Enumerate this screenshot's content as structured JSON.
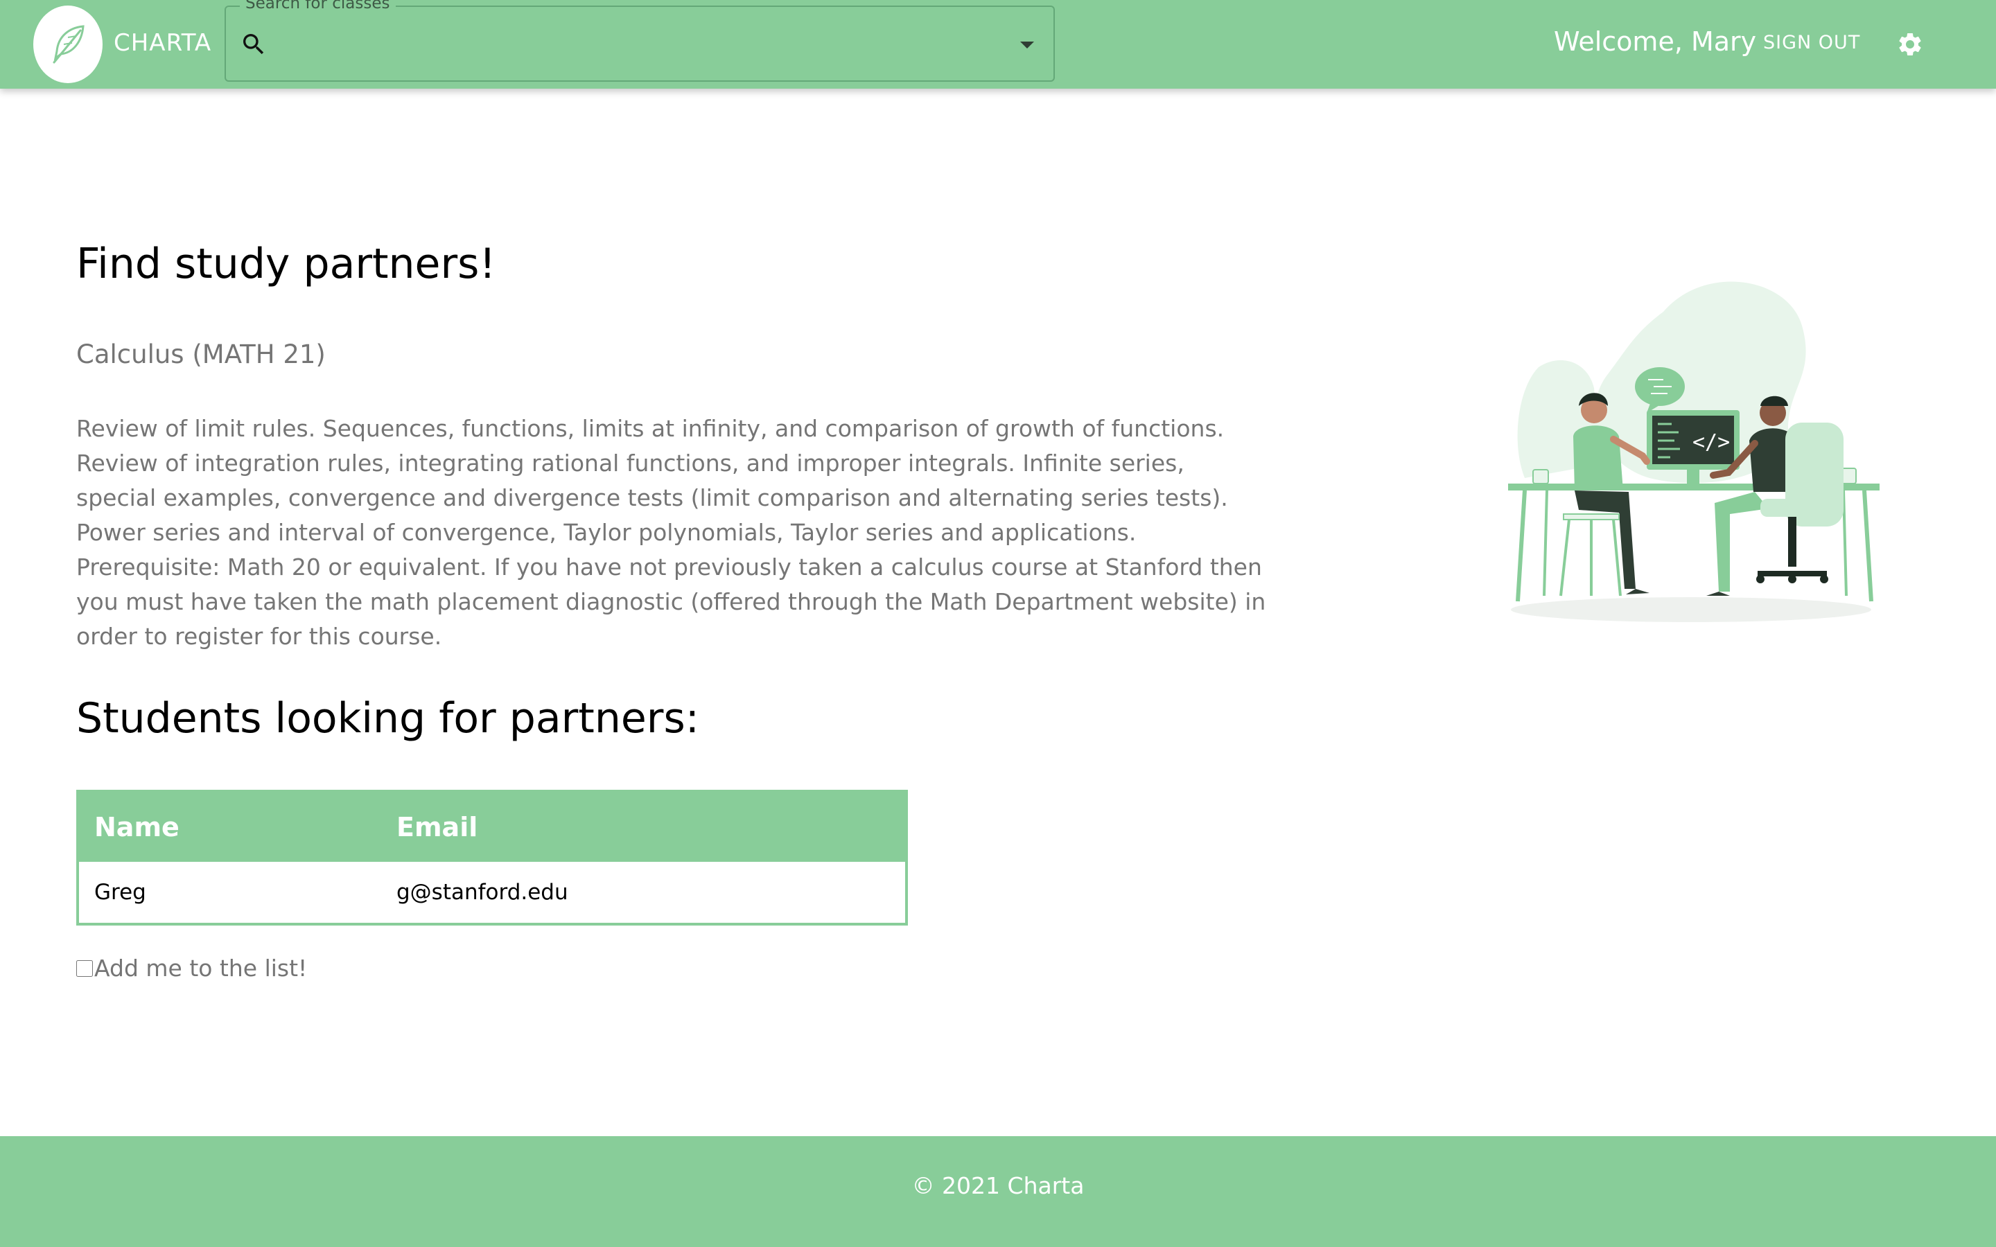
{
  "header": {
    "brand": "CHARTA",
    "search": {
      "legend": "Search for classes",
      "value": ""
    },
    "welcome": "Welcome, Mary",
    "sign_out": "SIGN OUT",
    "icons": {
      "logo": "feather-icon",
      "search": "search-icon",
      "dropdown": "arrow-drop-down-icon",
      "settings": "gear-icon"
    }
  },
  "main": {
    "title": "Find study partners!",
    "course_name": "Calculus (MATH 21)",
    "course_description": "Review of limit rules. Sequences, functions, limits at infinity, and comparison of growth of functions. Review of integration rules, integrating rational functions, and improper integrals. Infinite series, special examples, convergence and divergence tests (limit comparison and alternating series tests). Power series and interval of convergence, Taylor polynomials, Taylor series and applications. Prerequisite: Math 20 or equivalent. If you have not previously taken a calculus course at Stanford then you must have taken the math placement diagnostic (offered through the Math Department website) in order to register for this course.",
    "students_title": "Students looking for partners:",
    "table": {
      "headers": {
        "name": "Name",
        "email": "Email"
      },
      "rows": [
        {
          "name": "Greg",
          "email": "g@stanford.edu"
        }
      ]
    },
    "add_me_label": "Add me to the list!",
    "add_me_checked": false
  },
  "footer": {
    "text": "© 2021 Charta"
  },
  "colors": {
    "accent": "#88cd99",
    "dark_green": "#2f3e34",
    "muted_text": "#757575"
  }
}
